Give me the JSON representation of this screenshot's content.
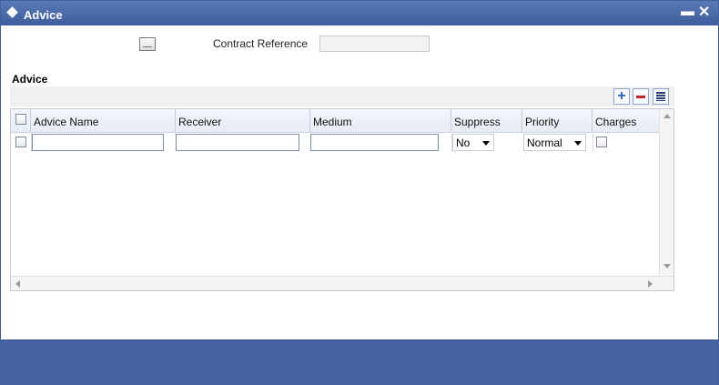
{
  "window": {
    "title": "Advice"
  },
  "header": {
    "contract_reference_label": "Contract Reference",
    "contract_reference_value": ""
  },
  "section": {
    "title": "Advice"
  },
  "toolbar": {
    "add_icon": "plus-icon",
    "delete_icon": "minus-icon",
    "view_icon": "list-icon"
  },
  "grid": {
    "columns": [
      "Advice Name",
      "Receiver",
      "Medium",
      "Suppress",
      "Priority",
      "Charges"
    ],
    "rows": [
      {
        "advice_name": "",
        "receiver": "",
        "medium": "",
        "suppress": "No",
        "priority": "Normal",
        "charges": false
      }
    ]
  },
  "colors": {
    "title_bar": "#4a6aaa",
    "footer": "#4762a1",
    "header_bg": "#eef2f8"
  }
}
